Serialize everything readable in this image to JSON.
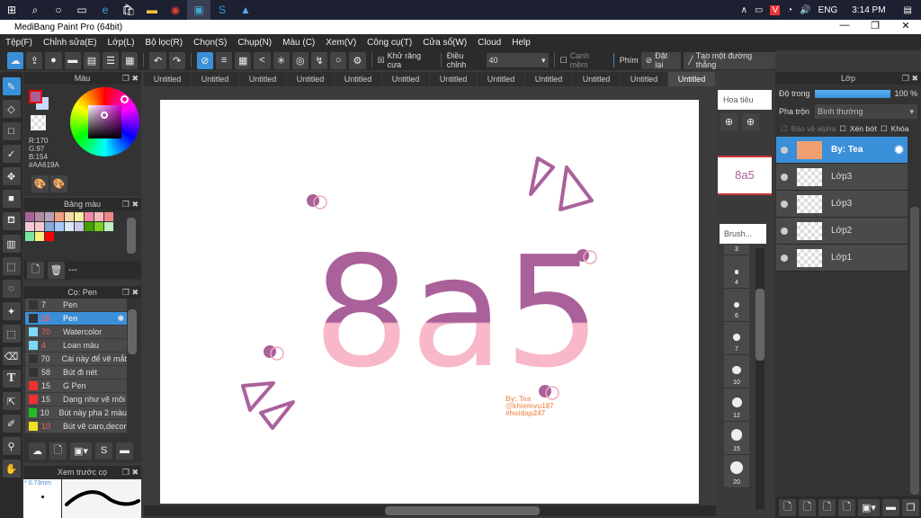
{
  "taskbar": {
    "icons": [
      "windows-icon",
      "search-icon",
      "cortana-icon",
      "task-view-icon",
      "edge-icon",
      "store-icon",
      "explorer-icon",
      "chrome-icon",
      "medibang-icon",
      "skype-icon",
      "app-icon"
    ],
    "lang": "ENG",
    "time": "3:14 PM"
  },
  "window": {
    "title": "MediBang Paint Pro (64bit)"
  },
  "menu": [
    "Tệp(F)",
    "Chỉnh sửa(E)",
    "Lớp(L)",
    "Bộ lọc(R)",
    "Chọn(S)",
    "Chụp(N)",
    "Màu (C)",
    "Xem(V)",
    "Công cụ(T)",
    "Cửa sổ(W)",
    "Cloud",
    "Help"
  ],
  "toolbar": {
    "antialias_label": "Khử răng cưa",
    "adjust_label": "Điều chỉnh",
    "adjust_value": "40",
    "soft_edge_label": "Cạnh mềm",
    "key_label": "Phím",
    "reset_label": "Đặt lại",
    "line_label": "Tạo một đường thẳng"
  },
  "tabs": [
    "Untitled",
    "Untitled",
    "Untitled",
    "Untitled",
    "Untitled",
    "Untitled",
    "Untitled",
    "Untitled",
    "Untitled",
    "Untitled",
    "Untitled",
    "Untitled"
  ],
  "color_panel": {
    "title": "Màu",
    "r": "R:170",
    "g": "G:97",
    "b": "B:154",
    "hex": "#AA619A",
    "primary": "#AA619A",
    "secondary": "#c8d8ff"
  },
  "palette": {
    "title": "Bảng màu",
    "colors": [
      "#aa619a",
      "#b08aa0",
      "#b8a0b8",
      "#f0a080",
      "#f8d8a8",
      "#f8f0a0",
      "#f08aa8",
      "#f8b8b8",
      "#f08888",
      "#f8c8d8",
      "#f8c8d0",
      "#88a8d8",
      "#a8c8f8",
      "#d8e8f8",
      "#c8c8f0",
      "#40a000",
      "#78d020",
      "#c0f0c0",
      "#78e8a0",
      "#f8f080",
      "#ff0000"
    ],
    "footer": "---"
  },
  "brush_panel": {
    "title": "Cọ: Pen",
    "items": [
      {
        "size": "7",
        "name": "Pen",
        "color": "#333333",
        "red": false
      },
      {
        "size": "10",
        "name": "Pen",
        "color": "#333333",
        "red": true
      },
      {
        "size": "70",
        "name": "Watercolor",
        "color": "#80d8f8",
        "red": true
      },
      {
        "size": "4",
        "name": "Loan màu",
        "color": "#80d8f8",
        "red": true
      },
      {
        "size": "70",
        "name": "Cái này để vẽ mắt",
        "color": "#333333",
        "red": false
      },
      {
        "size": "58",
        "name": "Bút đi nét",
        "color": "#333333",
        "red": false
      },
      {
        "size": "15",
        "name": "G Pen",
        "color": "#f03030",
        "red": false
      },
      {
        "size": "15",
        "name": "Dạng như vẽ môi",
        "color": "#f03030",
        "red": false
      },
      {
        "size": "10",
        "name": "Bút này pha 2 màu",
        "color": "#20c020",
        "red": false
      },
      {
        "size": "10",
        "name": "Bút vẽ caro,decor",
        "color": "#f0e020",
        "red": true
      }
    ]
  },
  "brush_preview": {
    "title": "Xem trước cọ",
    "size": "* 0.73mm"
  },
  "navigator": {
    "title": "Hoa tiêu"
  },
  "brush_size": {
    "title": "Brush...",
    "sizes": [
      "3",
      "4",
      "6",
      "7",
      "10",
      "12",
      "15",
      "20"
    ]
  },
  "artwork": {
    "text": "8a5",
    "credit": [
      "By: Tea",
      "@khiemvu187",
      "#hoidap247"
    ]
  },
  "layers": {
    "title": "Lớp",
    "opacity_label": "Độ trong",
    "opacity": 100,
    "opacity_text": "100 %",
    "blend_label": "Pha trộn",
    "blend_value": "Bình thường",
    "protect_alpha": "Bảo vệ alpha",
    "clip": "Xén bớt",
    "lock": "Khóa",
    "items": [
      "By: Tea",
      "Lớp3",
      "Lớp3",
      "Lớp2",
      "Lớp1"
    ]
  },
  "colors": {
    "accent": "#3a8fd9",
    "art_top": "#aa619a",
    "art_bottom": "#f8b8c8"
  }
}
